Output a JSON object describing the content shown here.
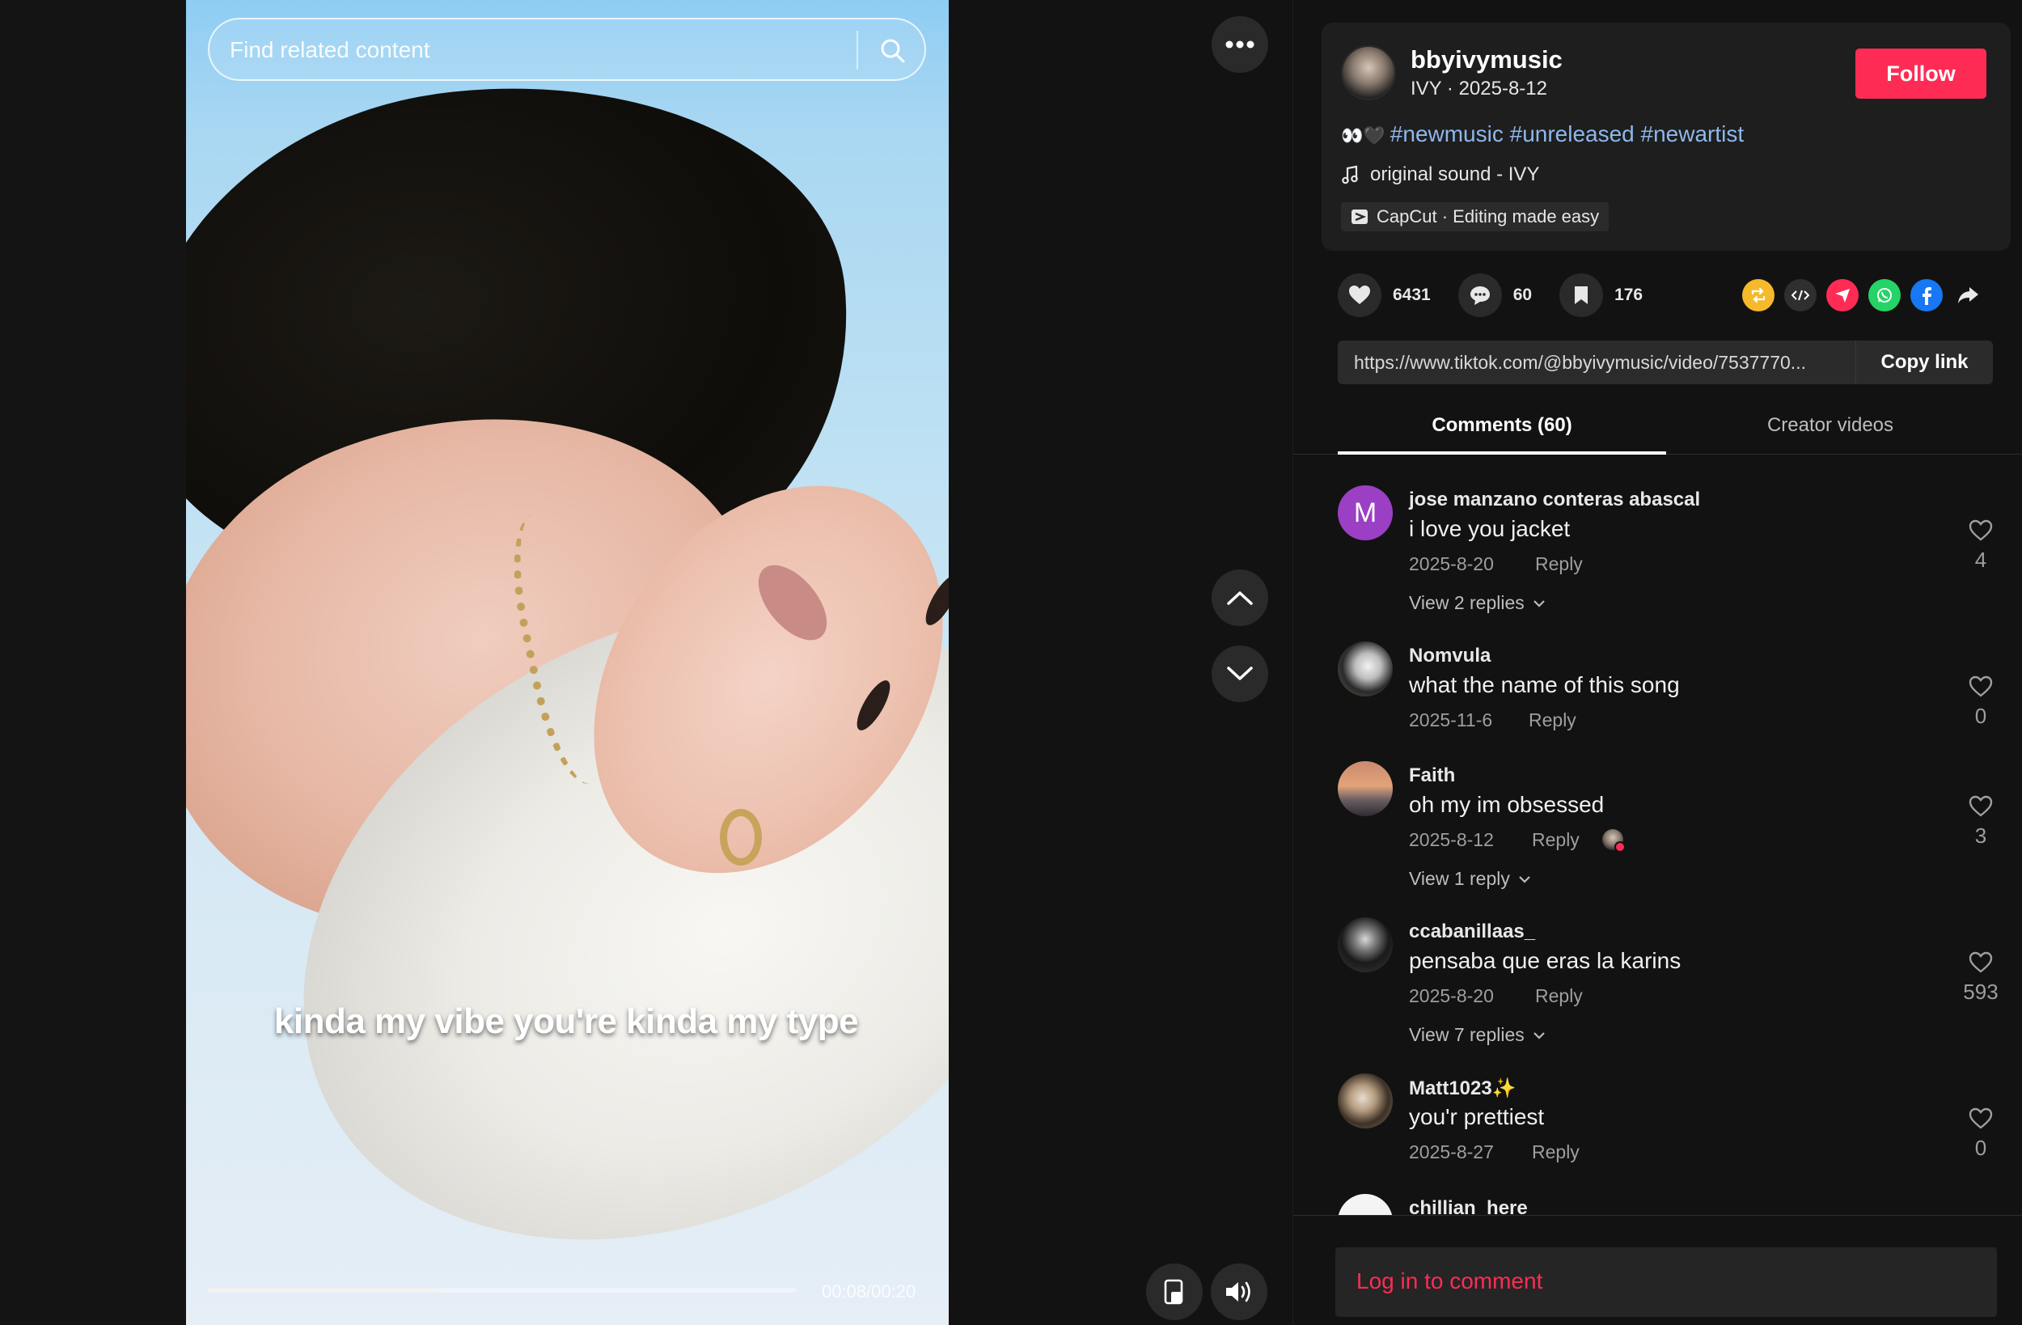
{
  "video": {
    "search_placeholder": "Find related content",
    "subtitle": "kinda my vibe you're kinda my type",
    "time": "00:08/00:20",
    "progress": 0.39
  },
  "author": {
    "username": "bbyivymusic",
    "meta": "IVY · 2025-8-12",
    "follow_label": "Follow",
    "emoji": "👀🖤",
    "hashtags": "#newmusic #unreleased #newartist",
    "sound": "original sound - IVY",
    "capcut": "CapCut · Editing made easy"
  },
  "stats": {
    "likes": "6431",
    "comments": "60",
    "saves": "176"
  },
  "share_icons": [
    "repost-icon",
    "embed-icon",
    "send-icon",
    "whatsapp-icon",
    "facebook-icon",
    "share-arrow-icon"
  ],
  "link": {
    "url": "https://www.tiktok.com/@bbyivymusic/video/7537770...",
    "copy_label": "Copy link"
  },
  "tabs": {
    "comments": "Comments (60)",
    "creator": "Creator videos"
  },
  "comments": [
    {
      "name": "jose manzano conteras abascal",
      "text": "i love you jacket",
      "date": "2025-8-20",
      "reply": "Reply",
      "likes": "4",
      "view": "View 2 replies",
      "avatar_letter": "M"
    },
    {
      "name": "Nomvula",
      "text": "what the name of this song",
      "date": "2025-11-6",
      "reply": "Reply",
      "likes": "0"
    },
    {
      "name": "Faith",
      "text": "oh my im obsessed",
      "date": "2025-8-12",
      "reply": "Reply",
      "likes": "3",
      "view": "View 1 reply"
    },
    {
      "name": "ccabanillaas_",
      "text": "pensaba que eras la karins",
      "date": "2025-8-20",
      "reply": "Reply",
      "likes": "593",
      "view": "View 7 replies"
    },
    {
      "name": "Matt1023✨",
      "text": "you'r prettiest",
      "date": "2025-8-27",
      "reply": "Reply",
      "likes": "0"
    },
    {
      "name": "chillian_here"
    }
  ],
  "login": "Log in to comment",
  "colors": {
    "accent": "#fe2c55",
    "hashtag": "#8eb8ec",
    "background": "#121212"
  }
}
